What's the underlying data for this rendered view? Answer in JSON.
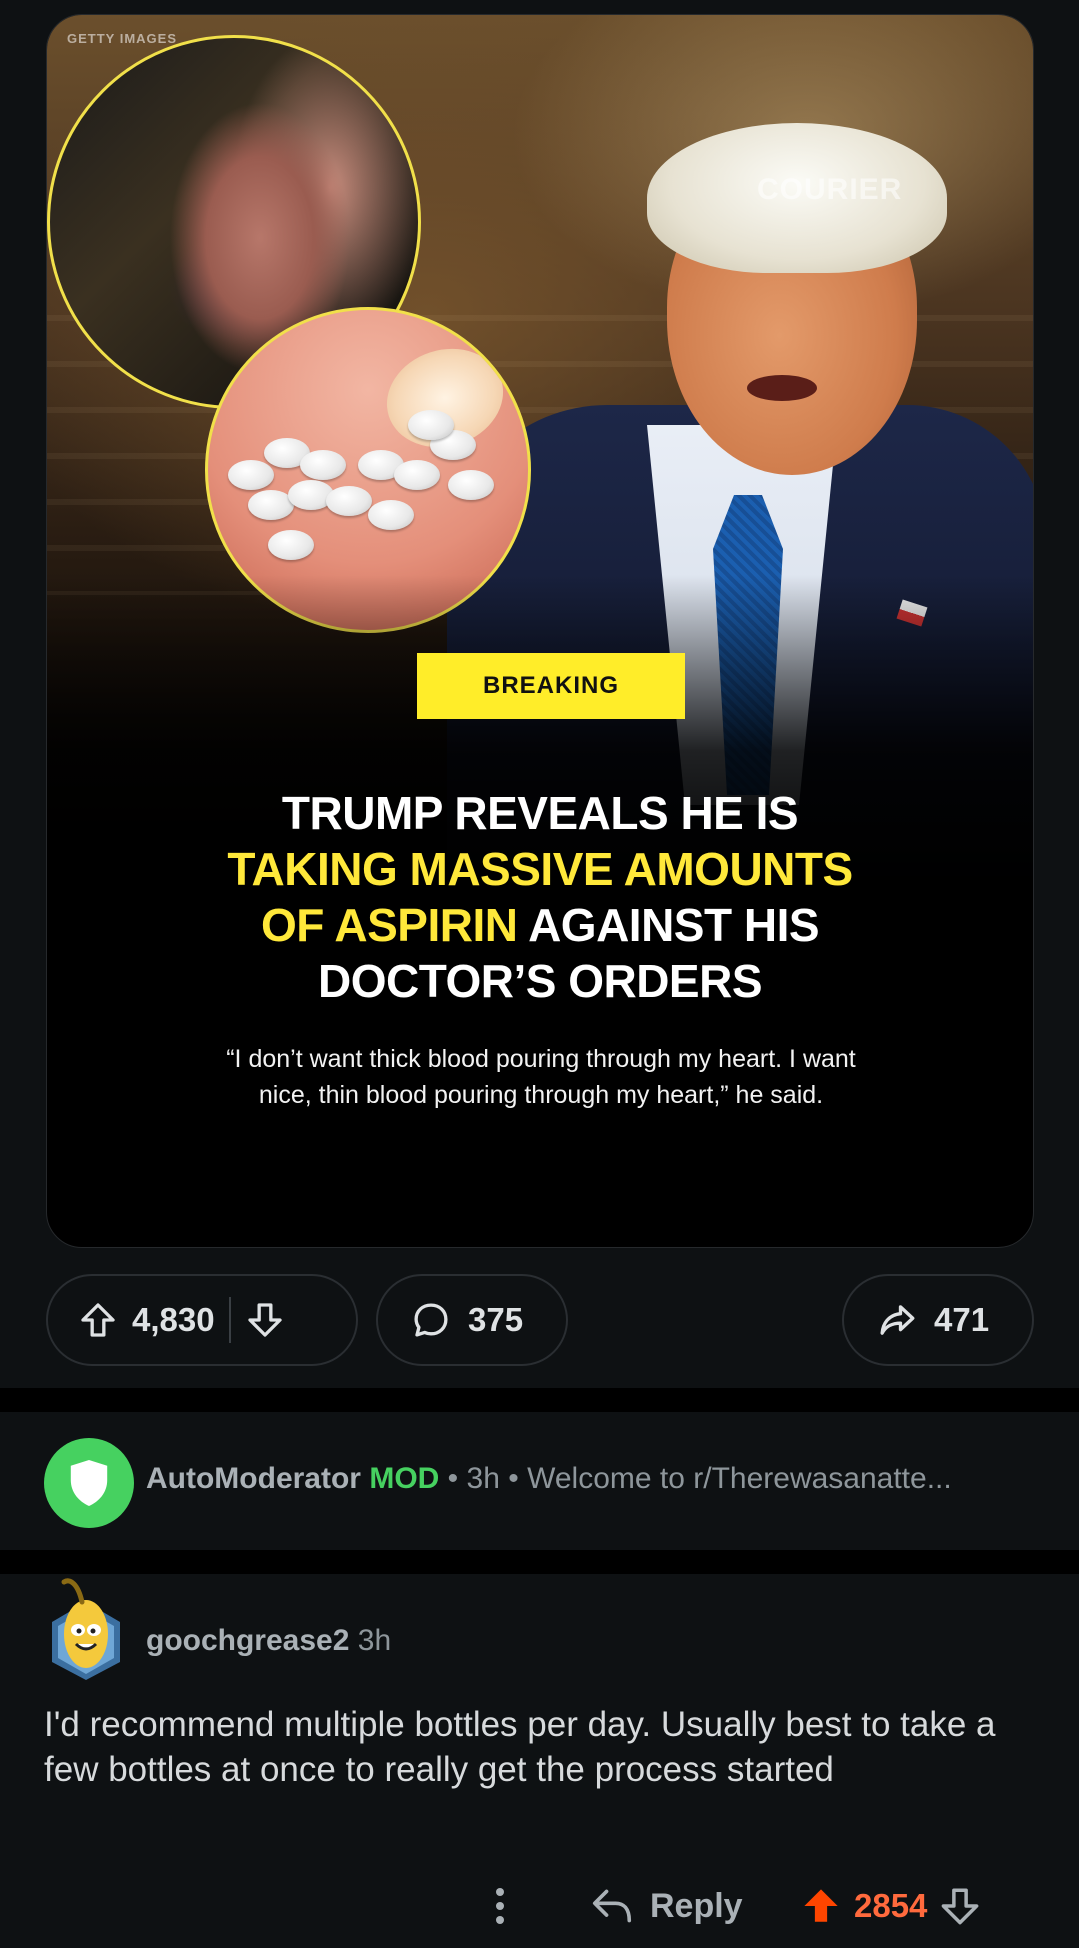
{
  "post": {
    "image": {
      "watermark_left": "GETTY IMAGES",
      "watermark_right": "COURIER",
      "badge": "BREAKING",
      "headline": {
        "line1": "TRUMP REVEALS HE IS",
        "line2": "TAKING MASSIVE AMOUNTS",
        "line3_yellow": "OF ASPIRIN",
        "line3_white": " AGAINST HIS",
        "line4": "DOCTOR’S ORDERS"
      },
      "quote_line1": "“I don’t want thick blood pouring through my heart. I want",
      "quote_line2": "nice, thin blood pouring through my heart,” he said.",
      "colors": {
        "badge": "#ffed29",
        "headline_accent": "#ffe83a"
      }
    },
    "upvotes": "4,830",
    "comments": "375",
    "shares": "471"
  },
  "automod": {
    "name": "AutoModerator",
    "tag": "MOD",
    "time": "3h",
    "preview": "Welcome to r/Therewasanatte...",
    "colors": {
      "avatar": "#46d160"
    }
  },
  "comment": {
    "author": "goochgrease2",
    "time": "3h",
    "body": "I'd recommend multiple bottles per day. Usually best to take a few bottles at once to really get the process started",
    "reply_label": "Reply",
    "score": "2854",
    "colors": {
      "upvoted": "#ff6a3d"
    }
  },
  "icons": {
    "upvote": "arrow-up-icon",
    "downvote": "arrow-down-icon",
    "comment": "speech-bubble-icon",
    "share": "share-arrow-icon",
    "more": "vertical-ellipsis-icon",
    "reply": "reply-arrow-icon",
    "mod_shield": "shield-icon"
  }
}
